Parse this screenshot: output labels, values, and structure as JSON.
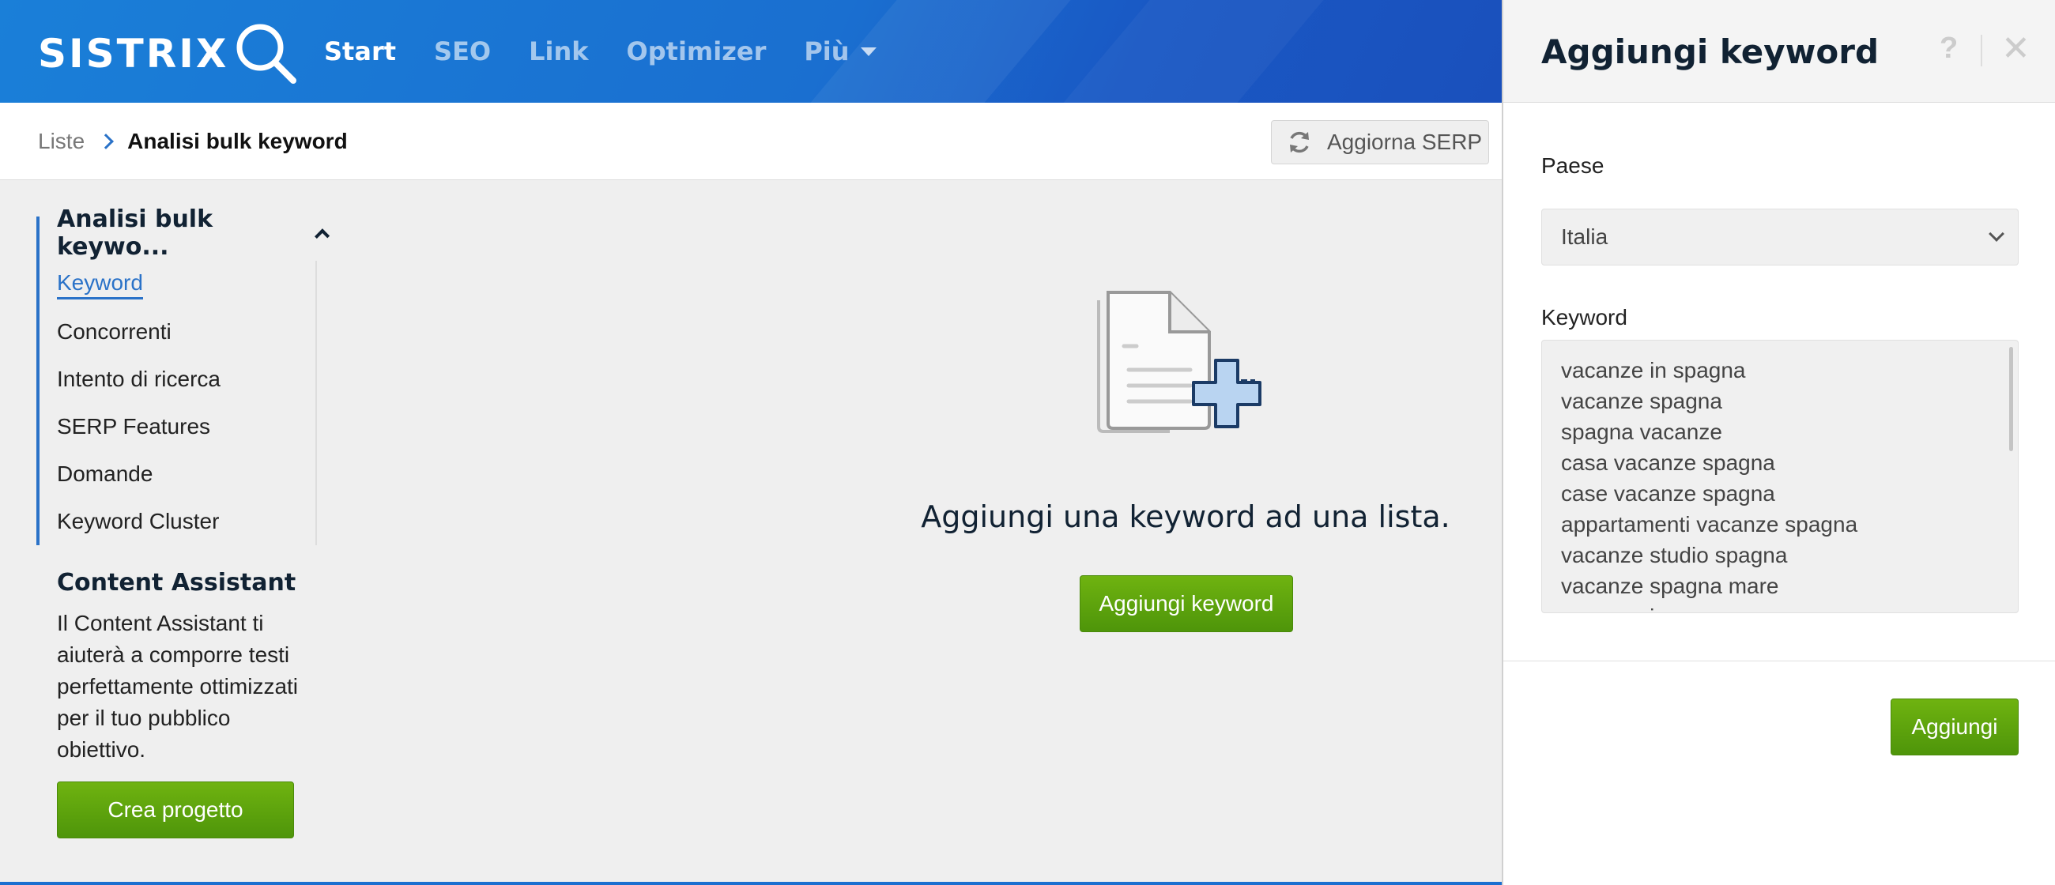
{
  "brand": {
    "logo_text": "SISTRIX"
  },
  "nav": {
    "items": [
      {
        "label": "Start",
        "active": true
      },
      {
        "label": "SEO",
        "active": false
      },
      {
        "label": "Link",
        "active": false
      },
      {
        "label": "Optimizer",
        "active": false
      },
      {
        "label": "Più",
        "active": false
      }
    ]
  },
  "breadcrumb": {
    "root": "Liste",
    "current": "Analisi bulk keyword"
  },
  "toolbar": {
    "refresh_label": "Aggiorna SERP"
  },
  "sidebar": {
    "group_title": "Analisi bulk keywo...",
    "items": [
      {
        "label": "Keyword",
        "active": true
      },
      {
        "label": "Concorrenti"
      },
      {
        "label": "Intento di ricerca"
      },
      {
        "label": "SERP Features"
      },
      {
        "label": "Domande"
      },
      {
        "label": "Keyword Cluster"
      }
    ],
    "content_assistant": {
      "title": "Content Assistant",
      "text": "Il Content Assistant ti aiuterà a comporre testi perfettamente ottimizzati per il tuo pubblico obiettivo.",
      "button": "Crea progetto"
    }
  },
  "main": {
    "empty_title": "Aggiungi una keyword ad una lista.",
    "empty_button": "Aggiungi keyword"
  },
  "panel": {
    "title": "Aggiungi keyword",
    "help": "?",
    "close": "✕",
    "country_label": "Paese",
    "country_value": "Italia",
    "keyword_label": "Keyword",
    "keywords": [
      "vacanze in spagna",
      "vacanze spagna",
      "spagna vacanze",
      "casa vacanze spagna",
      "case vacanze spagna",
      "appartamenti vacanze spagna",
      "vacanze studio spagna",
      "vacanze spagna mare",
      "vacanze in spagna mare"
    ],
    "submit": "Aggiungi"
  },
  "colors": {
    "brand_blue": "#1a6fd0",
    "action_green": "#5aa10c",
    "heading_navy": "#112233"
  }
}
